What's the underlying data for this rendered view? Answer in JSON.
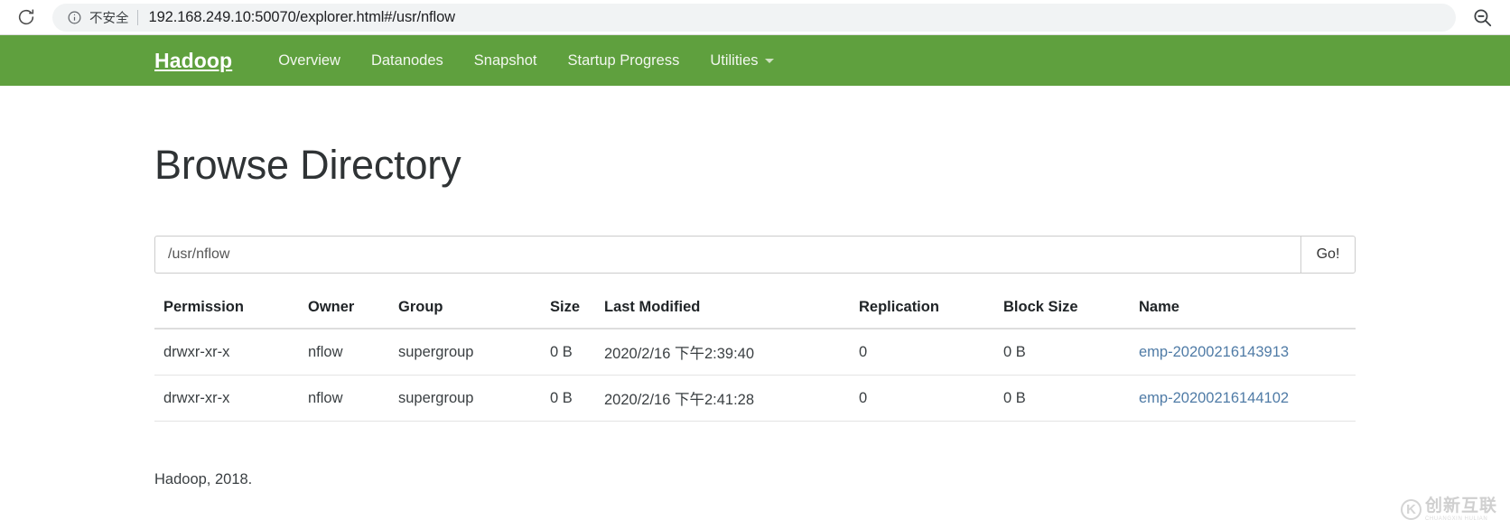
{
  "browser": {
    "reload_icon": "reload-icon",
    "info_icon": "info-circle-icon",
    "security_label": "不安全",
    "url": "192.168.249.10:50070/explorer.html#/usr/nflow",
    "zoom_out_icon": "zoom-out-icon"
  },
  "navbar": {
    "brand": "Hadoop",
    "brand_color": "#ffffff",
    "background_color": "#5fa03e",
    "links": [
      {
        "label": "Overview",
        "has_caret": false
      },
      {
        "label": "Datanodes",
        "has_caret": false
      },
      {
        "label": "Snapshot",
        "has_caret": false
      },
      {
        "label": "Startup Progress",
        "has_caret": false
      },
      {
        "label": "Utilities",
        "has_caret": true
      }
    ]
  },
  "main": {
    "title": "Browse Directory",
    "path_input": {
      "value": "/usr/nflow",
      "placeholder": "Enter a path"
    },
    "go_button": "Go!",
    "table": {
      "headers": [
        "Permission",
        "Owner",
        "Group",
        "Size",
        "Last Modified",
        "Replication",
        "Block Size",
        "Name"
      ],
      "rows": [
        {
          "permission": "drwxr-xr-x",
          "owner": "nflow",
          "group": "supergroup",
          "size": "0 B",
          "last_modified": "2020/2/16 下午2:39:40",
          "replication": "0",
          "block_size": "0 B",
          "name": "emp-20200216143913"
        },
        {
          "permission": "drwxr-xr-x",
          "owner": "nflow",
          "group": "supergroup",
          "size": "0 B",
          "last_modified": "2020/2/16 下午2:41:28",
          "replication": "0",
          "block_size": "0 B",
          "name": "emp-20200216144102"
        }
      ]
    },
    "link_color": "#4f7ba6"
  },
  "footer": {
    "text": "Hadoop, 2018."
  },
  "watermark": {
    "mark": "K",
    "cn_text": "创新互联",
    "en_text": "CHUANGXIN HULIAN"
  }
}
